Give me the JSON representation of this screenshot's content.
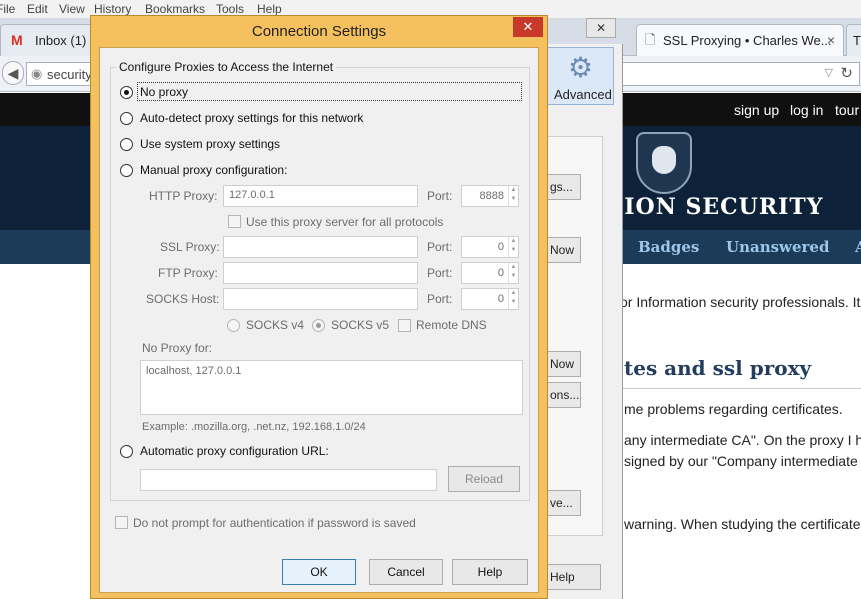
{
  "menubar": {
    "items": [
      "File",
      "Edit",
      "View",
      "History",
      "Bookmarks",
      "Tools",
      "Help"
    ]
  },
  "browser": {
    "tabs": [
      {
        "label": "Inbox (1) -",
        "icon": "gmail-icon"
      },
      {
        "label": "SSL Proxying • Charles We...",
        "icon": "page-icon",
        "close": "×"
      },
      {
        "label": "T"
      }
    ],
    "url_text": "security",
    "behind_close": "✕"
  },
  "website": {
    "top_links": [
      "sign up",
      "log in",
      "tour"
    ],
    "logo": "ATION SECURITY",
    "nav": [
      "Badges",
      "Unanswered",
      "A"
    ],
    "intro": "or Information security professionals. It",
    "question_title": "tes and ssl proxy",
    "lines": [
      "me problems regarding certificates.",
      "any intermediate CA\". On the proxy I h",
      "signed by our \"Company intermediate C",
      "warning. When studying the certificate"
    ]
  },
  "options_behind": {
    "advanced_label": "Advanced",
    "buttons": [
      "gs...",
      "Now",
      "Now",
      "ons...",
      "ve...",
      "Help"
    ]
  },
  "dialog": {
    "title": "Connection Settings",
    "close_label": "✕",
    "group_label": "Configure Proxies to Access the Internet",
    "options": {
      "no_proxy": "No proxy",
      "auto_detect": "Auto-detect proxy settings for this network",
      "system": "Use system proxy settings",
      "manual": "Manual proxy configuration:",
      "auto_url": "Automatic proxy configuration URL:"
    },
    "selected": "no_proxy",
    "http": {
      "label": "HTTP Proxy:",
      "value": "127.0.0.1",
      "port_label": "Port:",
      "port": "8888"
    },
    "use_all": "Use this proxy server for all protocols",
    "ssl": {
      "label": "SSL Proxy:",
      "value": "",
      "port_label": "Port:",
      "port": "0"
    },
    "ftp": {
      "label": "FTP Proxy:",
      "value": "",
      "port_label": "Port:",
      "port": "0"
    },
    "socks": {
      "label": "SOCKS Host:",
      "value": "",
      "port_label": "Port:",
      "port": "0"
    },
    "socks_v4": "SOCKS v4",
    "socks_v5": "SOCKS v5",
    "remote_dns": "Remote DNS",
    "no_proxy_for_label": "No Proxy for:",
    "no_proxy_for_value": "localhost, 127.0.0.1",
    "example": "Example: .mozilla.org, .net.nz, 192.168.1.0/24",
    "auto_url_value": "",
    "reload": "Reload",
    "no_prompt": "Do not prompt for authentication if password is saved",
    "ok": "OK",
    "cancel": "Cancel",
    "help": "Help"
  }
}
